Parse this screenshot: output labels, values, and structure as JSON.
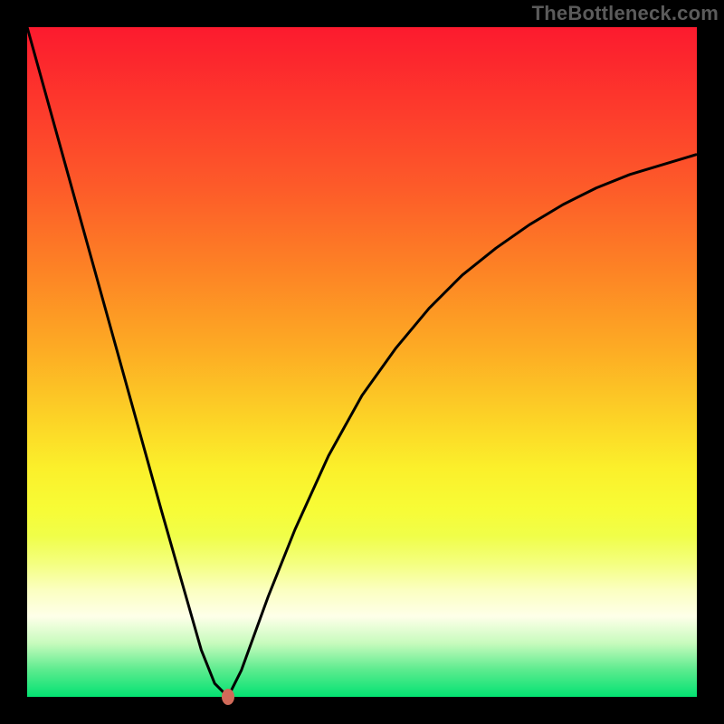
{
  "attribution": "TheBottleneck.com",
  "colors": {
    "frame": "#000000",
    "curve": "#000000",
    "marker": "#d16a59"
  },
  "chart_data": {
    "type": "line",
    "title": "",
    "xlabel": "",
    "ylabel": "",
    "x_range": [
      0,
      100
    ],
    "y_range": [
      0,
      100
    ],
    "marker": {
      "x": 30,
      "y": 0
    },
    "series": [
      {
        "name": "curve",
        "x": [
          0,
          5,
          10,
          15,
          20,
          24,
          26,
          28,
          30,
          32,
          36,
          40,
          45,
          50,
          55,
          60,
          65,
          70,
          75,
          80,
          85,
          90,
          95,
          100
        ],
        "y": [
          100,
          82,
          64,
          46,
          28,
          14,
          7,
          2,
          0,
          4,
          15,
          25,
          36,
          45,
          52,
          58,
          63,
          67,
          70.5,
          73.5,
          76,
          78,
          79.5,
          81
        ]
      }
    ],
    "gradient_stops": [
      {
        "pos": 0.0,
        "color": "#fc1a2e"
      },
      {
        "pos": 0.12,
        "color": "#fd3a2c"
      },
      {
        "pos": 0.24,
        "color": "#fd5b29"
      },
      {
        "pos": 0.36,
        "color": "#fd8225"
      },
      {
        "pos": 0.48,
        "color": "#fdab24"
      },
      {
        "pos": 0.58,
        "color": "#fcd126"
      },
      {
        "pos": 0.66,
        "color": "#fbf02b"
      },
      {
        "pos": 0.72,
        "color": "#f7fc36"
      },
      {
        "pos": 0.76,
        "color": "#f0fe49"
      },
      {
        "pos": 0.8,
        "color": "#f4ff7e"
      },
      {
        "pos": 0.84,
        "color": "#fbffc0"
      },
      {
        "pos": 0.88,
        "color": "#feffe9"
      },
      {
        "pos": 0.92,
        "color": "#c7fbbd"
      },
      {
        "pos": 0.96,
        "color": "#5beb8e"
      },
      {
        "pos": 1.0,
        "color": "#03e272"
      }
    ]
  }
}
